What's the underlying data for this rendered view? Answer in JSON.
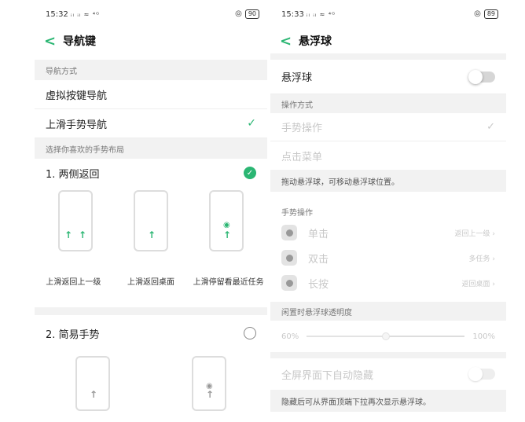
{
  "left": {
    "status": {
      "time": "15:32",
      "signal": "ᵢₗ ᵢₗ ≈ ⁴ᴳ",
      "battery": "90"
    },
    "title": "导航键",
    "section_nav_mode": "导航方式",
    "option_virtual": "虚拟按键导航",
    "option_swipe": "上滑手势导航",
    "section_layout": "选择你喜欢的手势布局",
    "layout1": {
      "label": "1. 两侧返回",
      "captions": [
        "上滑返回上一级",
        "上滑返回桌面",
        "上滑停留看最近任务"
      ]
    },
    "layout2": {
      "label": "2. 简易手势"
    }
  },
  "right": {
    "status": {
      "time": "15:33",
      "signal": "ᵢₗ ᵢₗ ≈ ⁴ᴳ",
      "battery": "89"
    },
    "title": "悬浮球",
    "floating_ball": "悬浮球",
    "section_mode": "操作方式",
    "mode_gesture": "手势操作",
    "mode_menu": "点击菜单",
    "hint_drag": "拖动悬浮球，可移动悬浮球位置。",
    "section_gestures": "手势操作",
    "gestures": [
      {
        "label": "单击",
        "value": "返回上一级"
      },
      {
        "label": "双击",
        "value": "多任务"
      },
      {
        "label": "长按",
        "value": "返回桌面"
      }
    ],
    "section_opacity": "闲置时悬浮球透明度",
    "opacity_min": "60%",
    "opacity_max": "100%",
    "opacity_level": 0.5,
    "auto_hide": "全屏界面下自动隐藏",
    "hint_hide": "隐藏后可从界面顶端下拉再次显示悬浮球。"
  },
  "colors": {
    "accent": "#2bb673",
    "section_bg": "#f2f2f2"
  }
}
